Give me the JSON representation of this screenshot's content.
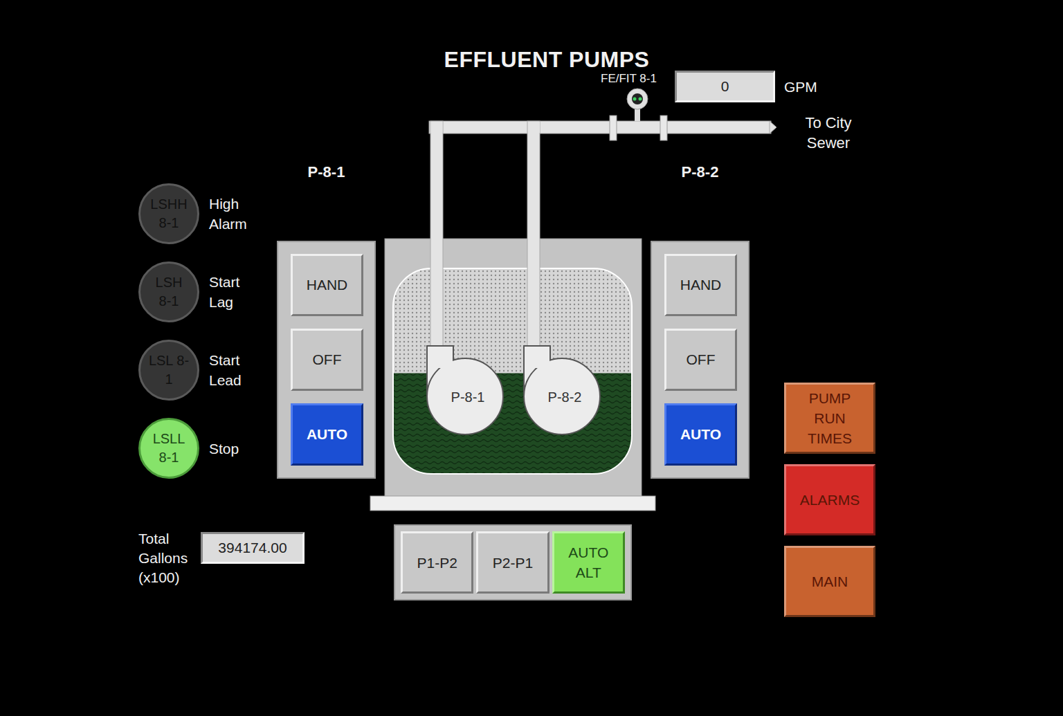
{
  "title": "EFFLUENT PUMPS",
  "flow_meter": {
    "tag": "FE/FIT 8-1",
    "value": "0",
    "unit": "GPM"
  },
  "destination": "To City Sewer",
  "level_switches": [
    {
      "tag": "LSHH 8-1",
      "label": "High Alarm",
      "active": false
    },
    {
      "tag": "LSH 8-1",
      "label": "Start Lag",
      "active": false
    },
    {
      "tag": "LSL 8-1",
      "label": "Start Lead",
      "active": false
    },
    {
      "tag": "LSLL 8-1",
      "label": "Stop",
      "active": true
    }
  ],
  "total": {
    "label": "Total Gallons (x100)",
    "value": "394174.00"
  },
  "pumps": [
    {
      "name": "P-8-1",
      "modes": [
        {
          "label": "HAND",
          "selected": false
        },
        {
          "label": "OFF",
          "selected": false
        },
        {
          "label": "AUTO",
          "selected": true
        }
      ]
    },
    {
      "name": "P-8-2",
      "modes": [
        {
          "label": "HAND",
          "selected": false
        },
        {
          "label": "OFF",
          "selected": false
        },
        {
          "label": "AUTO",
          "selected": true
        }
      ]
    }
  ],
  "tank": {
    "level": 0.49
  },
  "sequence": [
    {
      "label": "P1-P2",
      "selected": false
    },
    {
      "label": "P2-P1",
      "selected": false
    },
    {
      "label": "AUTO ALT",
      "selected": true
    }
  ],
  "nav_buttons": [
    {
      "label": "PUMP RUN TIMES",
      "color": "#c8622f"
    },
    {
      "label": "ALARMS",
      "color": "#d42b27"
    },
    {
      "label": "MAIN",
      "color": "#c8622f"
    }
  ]
}
